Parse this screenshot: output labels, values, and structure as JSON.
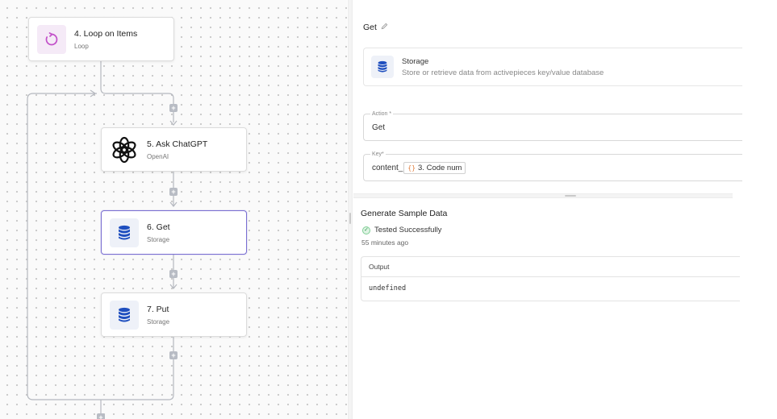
{
  "flow": {
    "steps": [
      {
        "title": "4. Loop on Items",
        "subtitle": "Loop",
        "icon": "loop-icon"
      },
      {
        "title": "5. Ask ChatGPT",
        "subtitle": "OpenAI",
        "icon": "openai-icon"
      },
      {
        "title": "6. Get",
        "subtitle": "Storage",
        "icon": "database-icon",
        "selected": true
      },
      {
        "title": "7. Put",
        "subtitle": "Storage",
        "icon": "database-icon"
      }
    ],
    "add_symbol": "+"
  },
  "panel": {
    "title": "Get",
    "piece": {
      "name": "Storage",
      "description": "Store or retrieve data from activepieces key/value database"
    },
    "action": {
      "label": "Action *",
      "value": "Get"
    },
    "key": {
      "label": "Key*",
      "prefix": "content_",
      "chip_icon": "{}",
      "chip_label": "3. Code num"
    },
    "sample": {
      "title": "Generate Sample Data",
      "status": "Tested Successfully",
      "time_ago": "55 minutes ago",
      "output_label": "Output",
      "output_value": "undefined"
    }
  },
  "colors": {
    "accent": "#7a6fd2",
    "loop": "#c24fc9",
    "storage": "#1f4fbf",
    "success": "#2f9e4f"
  }
}
